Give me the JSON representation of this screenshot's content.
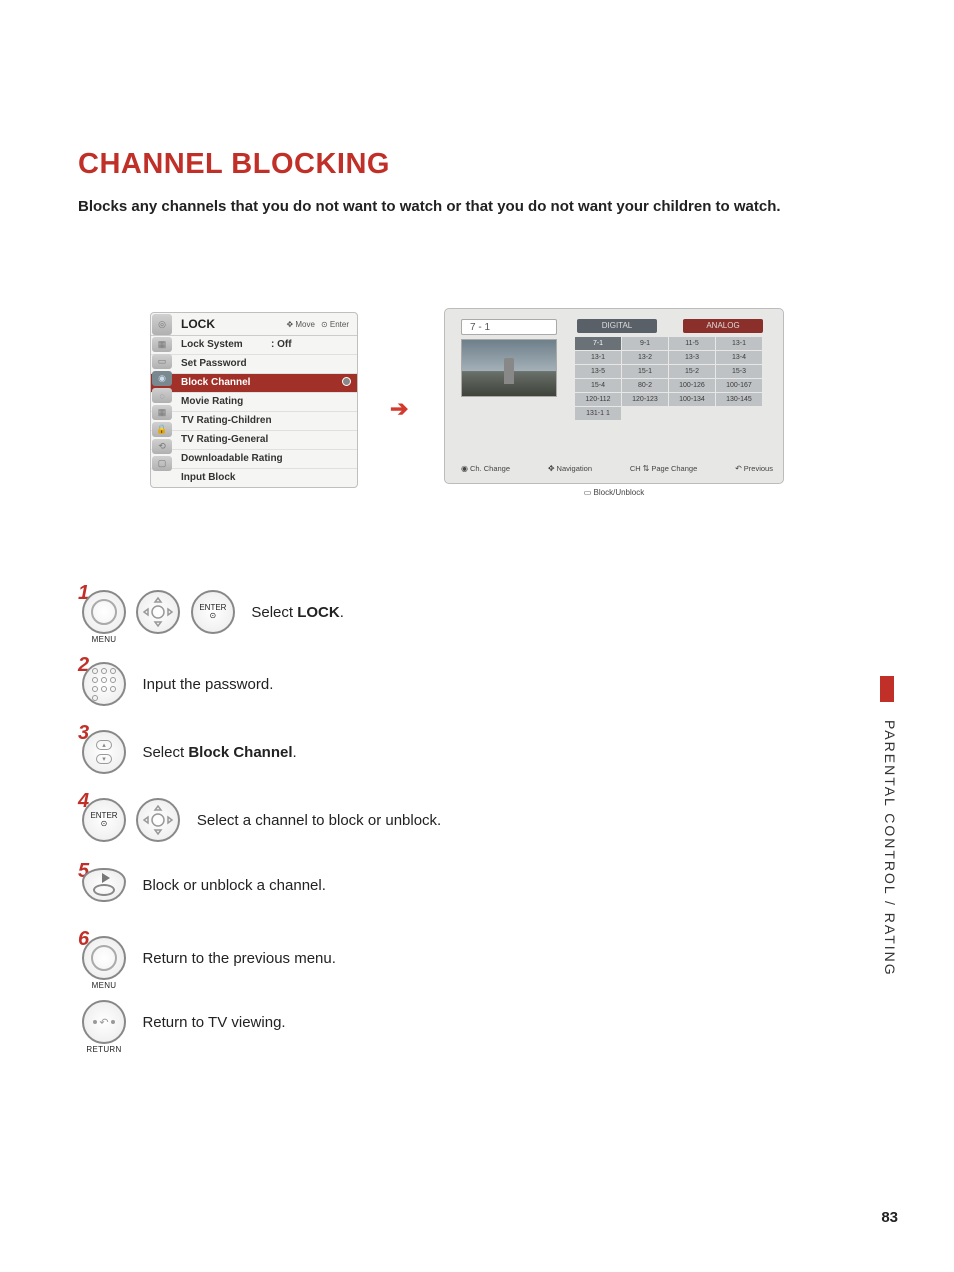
{
  "title": "CHANNEL BLOCKING",
  "subtitle": "Blocks any channels that you do not want to watch or that you do not want your children to watch.",
  "side_label": "PARENTAL CONTROL / RATING",
  "page_number": "83",
  "menu_btn": "MENU",
  "enter_btn": "ENTER",
  "return_btn": "RETURN",
  "osd_left": {
    "title": "LOCK",
    "hint_move": "Move",
    "hint_enter": "Enter",
    "items": [
      {
        "label": "Lock System",
        "value": ": Off"
      },
      {
        "label": "Set Password",
        "value": ""
      },
      {
        "label": "Block Channel",
        "value": ""
      },
      {
        "label": "Movie Rating",
        "value": ""
      },
      {
        "label": "TV Rating-Children",
        "value": ""
      },
      {
        "label": "TV Rating-General",
        "value": ""
      },
      {
        "label": "Downloadable Rating",
        "value": ""
      },
      {
        "label": "Input Block",
        "value": ""
      }
    ]
  },
  "osd_right": {
    "preview_channel": "7 - 1",
    "tab_digital": "DIGITAL",
    "tab_analog": "ANALOG",
    "grid": [
      [
        "7-1",
        "9-1",
        "11-5",
        "13-1"
      ],
      [
        "13-1",
        "13-2",
        "13-3",
        "13-4"
      ],
      [
        "13-5",
        "15-1",
        "15-2",
        "15-3"
      ],
      [
        "15-4",
        "80-2",
        "100-126",
        "100-167"
      ],
      [
        "120-112",
        "120-123",
        "100-134",
        "130-145"
      ],
      [
        "131-1 1",
        "",
        "",
        ""
      ]
    ],
    "hints": {
      "change": "Ch. Change",
      "nav": "Navigation",
      "page": "Page Change",
      "prev": "Previous",
      "block": "Block/Unblock",
      "ch_prefix": "CH"
    }
  },
  "steps": {
    "s1a": "Select ",
    "s1b": "LOCK",
    "s1c": ".",
    "s2": "Input the password.",
    "s3a": "Select ",
    "s3b": "Block Channel",
    "s3c": ".",
    "s4": "Select a channel to block or unblock.",
    "s5": "Block or unblock a channel.",
    "s6": "Return to the previous menu.",
    "s7": "Return to TV viewing."
  }
}
